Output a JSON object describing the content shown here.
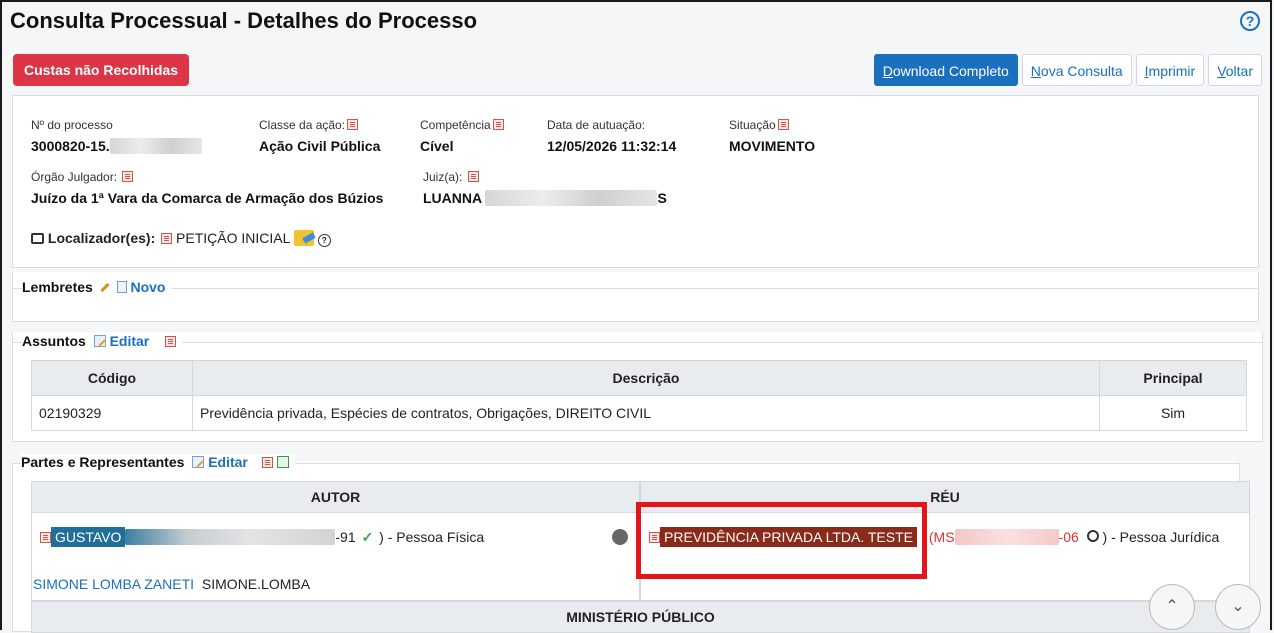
{
  "header": {
    "title": "Consulta Processual - Detalhes do Processo",
    "help_symbol": "?"
  },
  "status_badge": "Custas não Recolhidas",
  "toolbar": {
    "download_prefix": "D",
    "download_rest": "ownload Completo",
    "nova_prefix": "N",
    "nova_rest": "ova Consulta",
    "imprimir_prefix": "I",
    "imprimir_rest": "mprimir",
    "voltar_prefix": "V",
    "voltar_rest": "oltar"
  },
  "process": {
    "numero_label": "Nº do processo",
    "numero_value": "3000820-15.",
    "classe_label": "Classe da ação:",
    "classe_value": "Ação Civil Pública",
    "competencia_label": "Competência",
    "competencia_value": "Cível",
    "data_label": "Data de autuação:",
    "data_value": "12/05/2026 11:32:14",
    "situacao_label": "Situação",
    "situacao_value": "MOVIMENTO",
    "orgao_label": "Órgão Julgador:",
    "orgao_value": "Juízo da 1ª Vara da Comarca de Armação dos Búzios",
    "juiz_label": "Juiz(a):",
    "juiz_value": "LUANNA",
    "juiz_suffix": "S",
    "localizador_label": "Localizador(es):",
    "localizador_value": "PETIÇÃO INICIAL"
  },
  "lembretes": {
    "title": "Lembretes",
    "novo_label": "Novo"
  },
  "assuntos": {
    "title": "Assuntos",
    "editar_label": "Editar",
    "columns": [
      "Código",
      "Descrição",
      "Principal"
    ],
    "rows": [
      {
        "codigo": "02190329",
        "descricao": "Previdência privada, Espécies de contratos, Obrigações, DIREITO CIVIL",
        "principal": "Sim"
      }
    ]
  },
  "partes": {
    "title": "Partes e Representantes",
    "editar_label": "Editar",
    "autor_header": "AUTOR",
    "reu_header": "RÉU",
    "autor_name": "GUSTAVO",
    "autor_doc_suffix": "-91",
    "autor_tipo": ") - Pessoa Física",
    "reu_name": "PREVIDÊNCIA PRIVADA LTDA. TESTE",
    "reu_doc_prefix": "MS",
    "reu_doc_suffix": "-06",
    "reu_tipo": ") - Pessoa Jurídica",
    "rep_name": "SIMONE LOMBA ZANETI",
    "rep_login": "SIMONE.LOMBA",
    "mp_header": "MINISTÉRIO PÚBLICO"
  },
  "colors": {
    "accent": "#1a6fbf",
    "danger": "#dc3545",
    "highlight_border": "#e4141b",
    "reu_tag": "#8a2b1a"
  }
}
